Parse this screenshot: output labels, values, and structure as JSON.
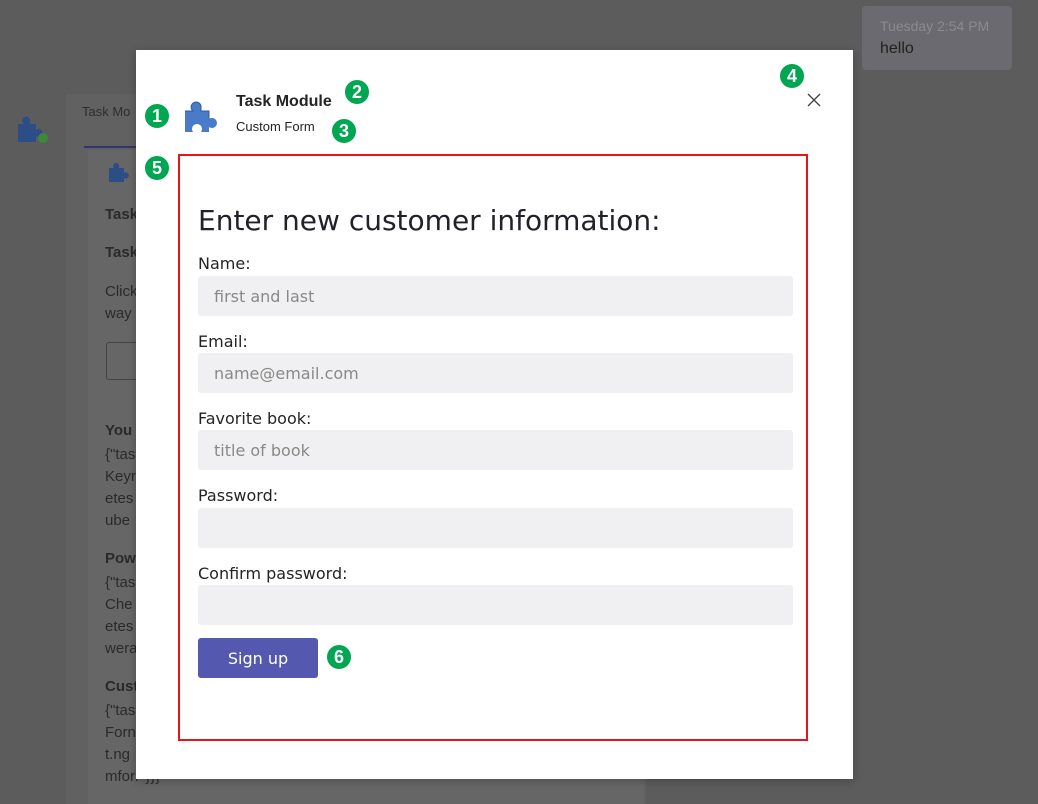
{
  "background": {
    "message_time": "Tuesday 2:54 PM",
    "message_text": "hello",
    "tab_label": "Task Mo",
    "card_lines": [
      "Task",
      "Task",
      "Click",
      "way",
      "You",
      "{\"tas",
      "Keyr",
      "etes",
      "ube",
      "Pow",
      "{\"tas",
      "Che",
      "etes",
      "wera",
      "Cust",
      "{\"tas",
      "Forn",
      "t.ng",
      "mforr\"}}}"
    ]
  },
  "modal": {
    "title": "Task Module",
    "subtitle": "Custom Form",
    "close_icon": "close-icon",
    "app_icon": "puzzle-piece-icon"
  },
  "form": {
    "heading": "Enter new customer information:",
    "fields": [
      {
        "label": "Name:",
        "placeholder": "first and last",
        "value": ""
      },
      {
        "label": "Email:",
        "placeholder": "name@email.com",
        "value": ""
      },
      {
        "label": "Favorite book:",
        "placeholder": "title of book",
        "value": ""
      },
      {
        "label": "Password:",
        "placeholder": "",
        "value": ""
      },
      {
        "label": "Confirm password:",
        "placeholder": "",
        "value": ""
      }
    ],
    "submit_label": "Sign up"
  },
  "badges": [
    "1",
    "2",
    "3",
    "4",
    "5",
    "6"
  ],
  "colors": {
    "accent": "#5558af",
    "badge": "#00a651",
    "highlight_border": "#e8141b",
    "input_bg": "#f0f0f2"
  }
}
